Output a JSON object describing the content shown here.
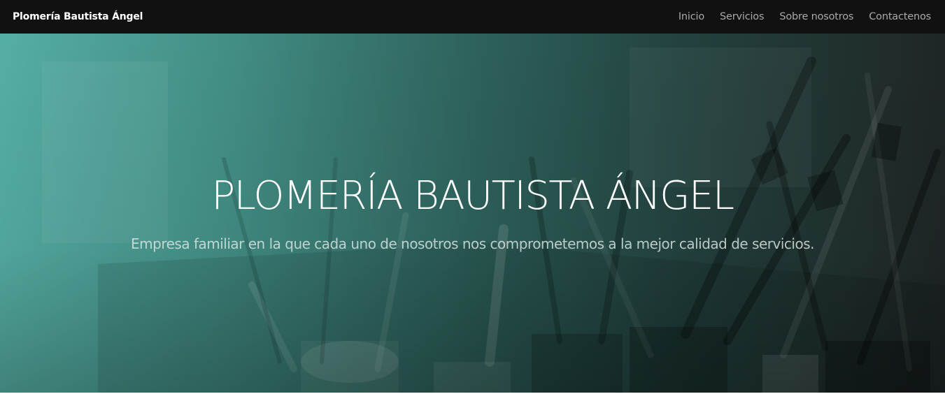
{
  "navbar": {
    "brand": "Plomería Bautista Ángel",
    "links": [
      "Inicio",
      "Servicios",
      "Sobre nosotros",
      "Contactenos"
    ]
  },
  "hero": {
    "title": "PLOMERÍA BAUTISTA ÁNGEL",
    "subtitle": "Empresa familiar en la que cada uno de nosotros nos comprometemos a la mejor calidad de servicios."
  },
  "colors": {
    "navbar_bg": "#111111",
    "nav_link": "#a9a9a9",
    "hero_teal": "#52ada3",
    "hero_dark": "#1b2221"
  }
}
